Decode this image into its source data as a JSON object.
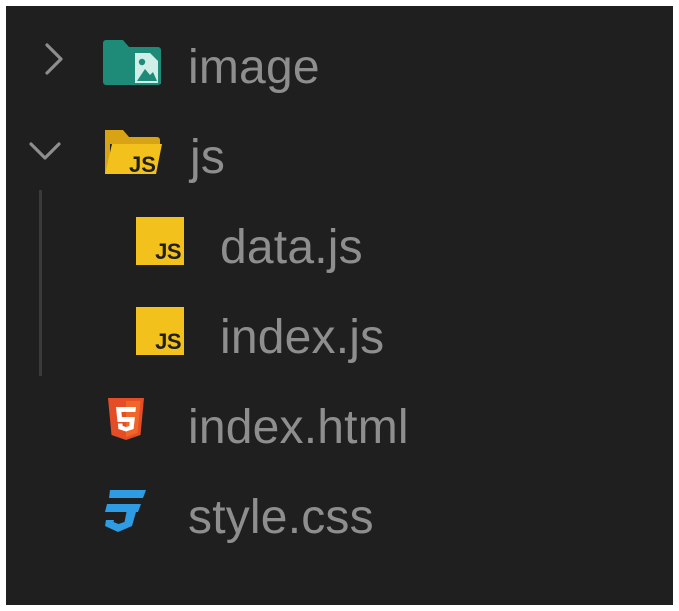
{
  "tree": {
    "items": [
      {
        "label": "image",
        "type": "folder",
        "expanded": false,
        "icon": "folder-image-icon",
        "color": "#1e8a78"
      },
      {
        "label": "js",
        "type": "folder",
        "expanded": true,
        "icon": "folder-js-icon",
        "color": "#f3c11b"
      },
      {
        "label": "data.js",
        "type": "file",
        "icon": "js-file-icon",
        "badge": "JS",
        "color": "#f3c11b"
      },
      {
        "label": "index.js",
        "type": "file",
        "icon": "js-file-icon",
        "badge": "JS",
        "color": "#f3c11b"
      },
      {
        "label": "index.html",
        "type": "file",
        "icon": "html5-icon",
        "badge": "5",
        "color": "#e44d26"
      },
      {
        "label": "style.css",
        "type": "file",
        "icon": "css3-icon",
        "badge": "3",
        "color": "#2f9be3"
      }
    ]
  },
  "colors": {
    "background": "#1f1f1f",
    "text": "#8e8e8e",
    "chevron": "#8e8e8e",
    "indent_guide": "#3a3a3a"
  }
}
